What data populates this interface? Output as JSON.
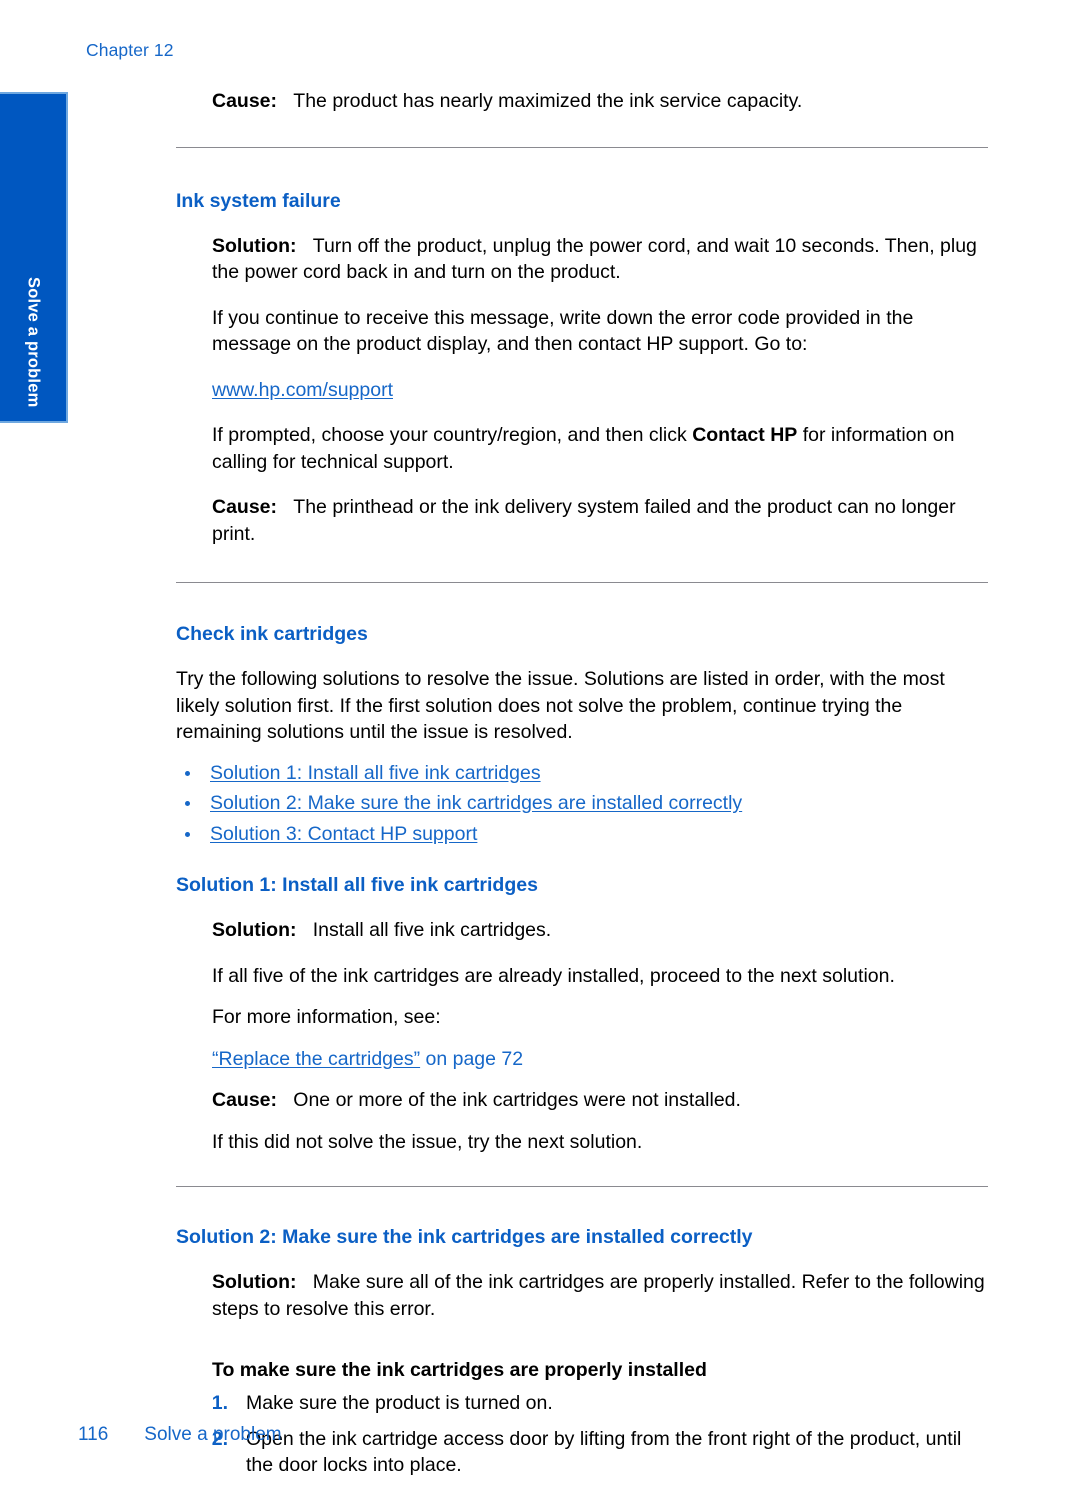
{
  "page": {
    "chapter_label": "Chapter 12",
    "side_tab_label": "Solve a problem",
    "footer_page_number": "116",
    "footer_section": "Solve a problem",
    "accent_blue": "#0B5FC4",
    "link_blue": "#1667C8",
    "tab_blue": "#0057C0",
    "rule_color": "#8A8A90"
  },
  "top_cause": {
    "label": "Cause:",
    "text": "The product has nearly maximized the ink service capacity."
  },
  "ink_system_failure": {
    "heading": "Ink system failure",
    "solution_label": "Solution:",
    "solution_text": "Turn off the product, unplug the power cord, and wait 10 seconds. Then, plug the power cord back in and turn on the product.",
    "para_error_code": "If you continue to receive this message, write down the error code provided in the message on the product display, and then contact HP support. Go to:",
    "support_url": "www.hp.com/support",
    "prompt_para_1": "If prompted, choose your country/region, and then click ",
    "prompt_bold": "Contact HP",
    "prompt_para_2": " for information on calling for technical support.",
    "cause_label": "Cause:",
    "cause_text": "The printhead or the ink delivery system failed and the product can no longer print."
  },
  "check_ink_cartridges": {
    "heading": "Check ink cartridges",
    "intro": "Try the following solutions to resolve the issue. Solutions are listed in order, with the most likely solution first. If the first solution does not solve the problem, continue trying the remaining solutions until the issue is resolved.",
    "solution_links": [
      "Solution 1: Install all five ink cartridges",
      "Solution 2: Make sure the ink cartridges are installed correctly",
      "Solution 3: Contact HP support"
    ]
  },
  "solution_1": {
    "heading": "Solution 1: Install all five ink cartridges",
    "solution_label": "Solution:",
    "solution_text": "Install all five ink cartridges.",
    "para_already_installed": "If all five of the ink cartridges are already installed, proceed to the next solution.",
    "para_more_info": "For more information, see:",
    "cross_ref_link": "“Replace the cartridges”",
    "cross_ref_suffix": " on page 72",
    "cause_label": "Cause:",
    "cause_text": "One or more of the ink cartridges were not installed.",
    "para_next_solution": "If this did not solve the issue, try the next solution."
  },
  "solution_2": {
    "heading": "Solution 2: Make sure the ink cartridges are installed correctly",
    "solution_label": "Solution:",
    "solution_text": "Make sure all of the ink cartridges are properly installed. Refer to the following steps to resolve this error.",
    "procedure_heading": "To make sure the ink cartridges are properly installed",
    "steps": [
      {
        "num": "1.",
        "text": "Make sure the product is turned on."
      },
      {
        "num": "2.",
        "text": "Open the ink cartridge access door by lifting from the front right of the product, until the door locks into place."
      }
    ]
  }
}
